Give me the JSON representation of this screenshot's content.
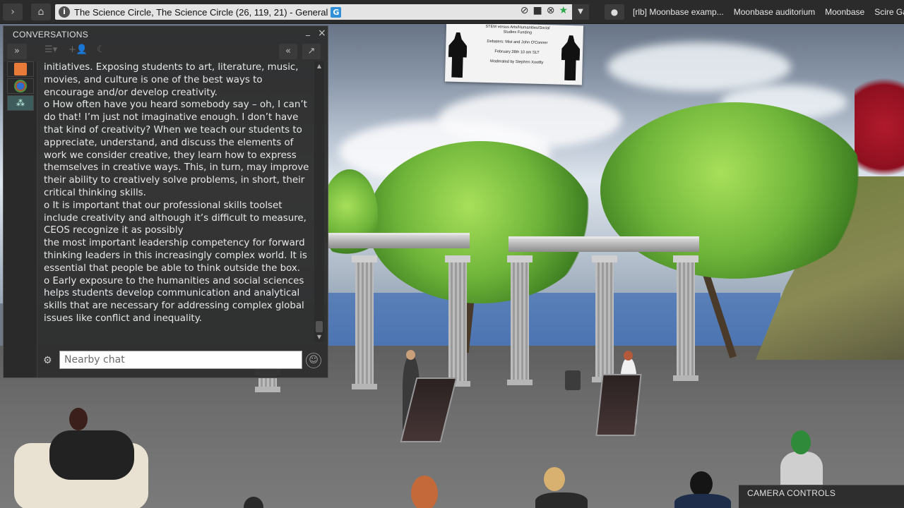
{
  "topbar": {
    "location": "The Science Circle, The Science Circle (26, 119, 21) - General",
    "rating_badge": "G",
    "favorites": [
      "[rlb] Moonbase examp...",
      "Moonbase auditorium",
      "Moonbase",
      "Scire Ga"
    ]
  },
  "billboard": {
    "lines": [
      "STEM versus Arts/Humanities/Social",
      "Studies Funding",
      "",
      "Debaters: Mist and John O'Conner",
      "",
      "February 28th 10 am SLT",
      "",
      "Moderated by Stephen Xootfly"
    ]
  },
  "conversations": {
    "title": "CONVERSATIONS",
    "minimize_glyph": "_",
    "close_glyph": "×",
    "chat_lines": [
      "initiatives. Exposing students to art, literature, music, movies, and culture is one of the best ways to encourage and/or develop creativity.",
      "o How often have you heard somebody say – oh, I can’t do that!  I’m just not imaginative enough. I don’t have that kind of creativity? When we teach our students to appreciate, understand, and discuss the elements of work we consider creative, they learn how to express themselves in creative ways. This, in turn, may improve their ability to creatively solve problems, in short, their critical thinking skills.",
      "o It is important that our professional skills toolset include creativity and although it’s difficult to measure, CEOS recognize it as possibly",
      " the most important leadership competency for forward thinking leaders in this increasingly complex world. It is essential that people be able to think outside the box.",
      "o Early exposure to the humanities and social sciences helps students develop communication and analytical skills that are necessary for addressing complex global issues like conflict and inequality."
    ],
    "chat_placeholder": "Nearby chat"
  },
  "camera_controls": {
    "title": "CAMERA CONTROLS"
  },
  "colors": {
    "panel_bg": "#2e2e2e",
    "topbar_bg": "#2b2b2b",
    "location_bg": "#e4e4e4",
    "rating_badge": "#2f8fd8",
    "foliage": "#6fb53a",
    "sea": "#4a73b0"
  },
  "icons": {
    "back": "chevron-right-icon",
    "home": "home-icon",
    "info": "info-icon",
    "expand": "double-chevron-right-icon",
    "collapse": "double-chevron-left-icon",
    "undock": "arrow-up-right-icon",
    "emoji": "smiley-icon",
    "chat_gear": "gear-icon"
  }
}
